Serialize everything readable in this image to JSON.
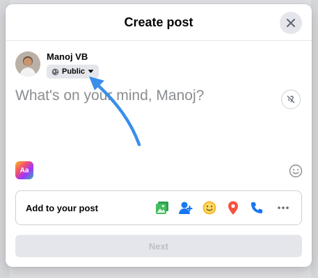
{
  "dialog": {
    "title": "Create post",
    "close_icon": "close-icon"
  },
  "user": {
    "name": "Manoj VB",
    "audience": {
      "label": "Public",
      "icon": "globe-icon",
      "dropdown_icon": "caret-down-icon"
    }
  },
  "composer": {
    "placeholder": "What's on your mind, Manoj?",
    "voice_icon": "voice-icon",
    "background_picker_label": "Aa",
    "emoji_icon": "emoji-icon"
  },
  "add_to_post": {
    "label": "Add to your post",
    "icons": [
      {
        "name": "photo-video-icon",
        "color": "#45bd62"
      },
      {
        "name": "tag-people-icon",
        "color": "#1877f2"
      },
      {
        "name": "feeling-icon",
        "color": "#f7b928"
      },
      {
        "name": "check-in-icon",
        "color": "#f5533d"
      },
      {
        "name": "call-icon",
        "color": "#1877f2"
      },
      {
        "name": "more-icon",
        "color": "#65676b"
      }
    ]
  },
  "footer": {
    "next_label": "Next"
  },
  "annotation": {
    "arrow_color": "#3b8eea"
  }
}
